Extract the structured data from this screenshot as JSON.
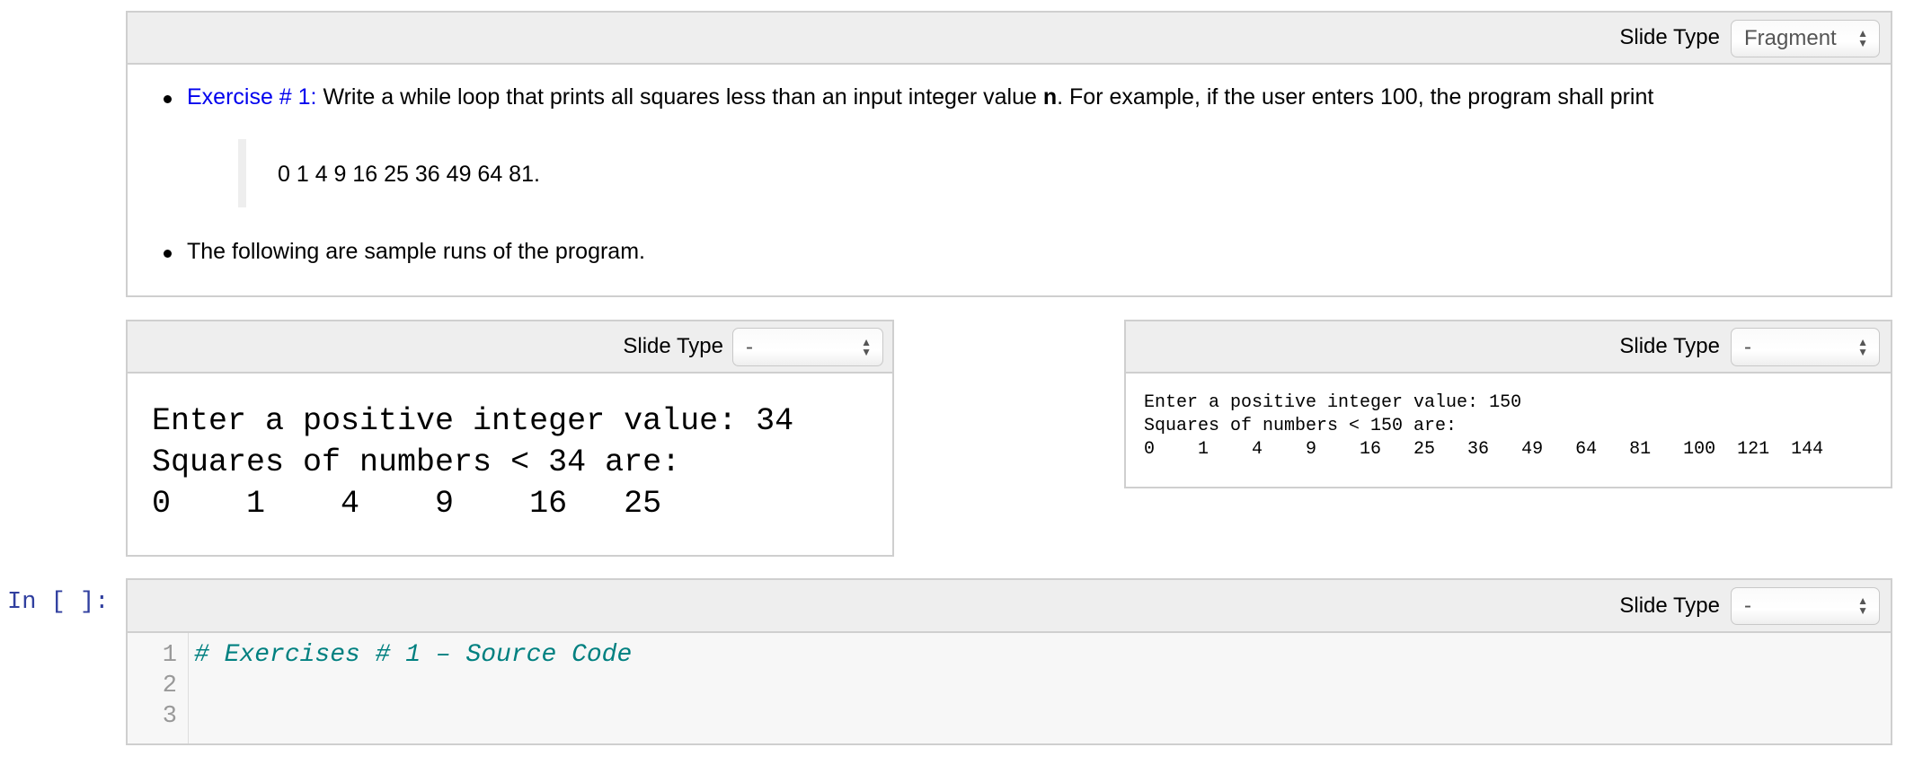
{
  "slide_type_label": "Slide Type",
  "cells": {
    "exercise": {
      "slide_type": "Fragment",
      "bullet1_link": "Exercise # 1:",
      "bullet1_text_a": " Write a while loop that prints all squares less than an input integer value ",
      "bullet1_bold": "n",
      "bullet1_text_b": ". For example, if the user enters 100, the program shall print",
      "blockquote": "0 1 4 9 16 25 36 49 64 81.",
      "bullet2": "The following are sample runs of the program."
    },
    "sample1": {
      "slide_type": "-",
      "lines": [
        "Enter a positive integer value: 34",
        "Squares of numbers < 34 are:",
        "0    1    4    9    16   25"
      ]
    },
    "sample2": {
      "slide_type": "-",
      "lines": [
        "Enter a positive integer value: 150",
        "Squares of numbers < 150 are:",
        "0    1    4    9    16   25   36   49   64   81   100  121  144"
      ]
    },
    "code": {
      "prompt": "In [ ]:",
      "slide_type": "-",
      "line_numbers": [
        "1",
        "2",
        "3"
      ],
      "lines": [
        "# Exercises # 1 – Source Code",
        "",
        ""
      ]
    }
  },
  "colors": {
    "link": "#0000ee",
    "comment": "#008080",
    "prompt": "#303f9f"
  }
}
